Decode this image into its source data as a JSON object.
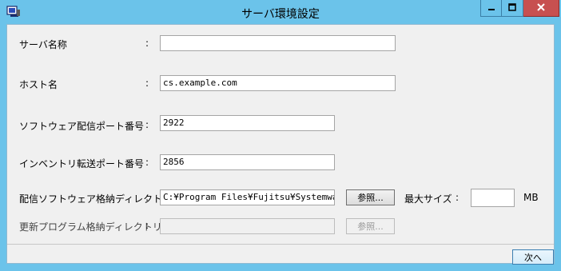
{
  "window": {
    "title": "サーバ環境設定",
    "minimize_icon": "minimize-icon",
    "maximize_icon": "maximize-icon",
    "close_icon": "close-icon"
  },
  "form": {
    "server_name": {
      "label": "サーバ名称",
      "colon": ":",
      "value": ""
    },
    "host_name": {
      "label": "ホスト名",
      "colon": ":",
      "value": "cs.example.com"
    },
    "sw_dist_port": {
      "label": "ソフトウェア配信ポート番号",
      "colon": ":",
      "value": "2922"
    },
    "inventory_port": {
      "label": "インベントリ転送ポート番号",
      "colon": ":",
      "value": "2856"
    },
    "dist_sw_dir": {
      "label": "配信ソフトウェア格納ディレクトリ",
      "colon": ":",
      "value": "C:¥Program Files¥Fujitsu¥Systemwalke",
      "browse_label": "参照..."
    },
    "max_size": {
      "label": "最大サイズ",
      "colon": ":",
      "value": "",
      "unit": "MB"
    },
    "update_prog_dir": {
      "label": "更新プログラム格納ディレクトリ",
      "colon": ":",
      "value": "",
      "browse_label": "参照..."
    }
  },
  "footer": {
    "next_label": "次へ"
  },
  "colors": {
    "titlebar": "#6bc3ea",
    "close": "#c75050",
    "client": "#f0f0f0"
  }
}
